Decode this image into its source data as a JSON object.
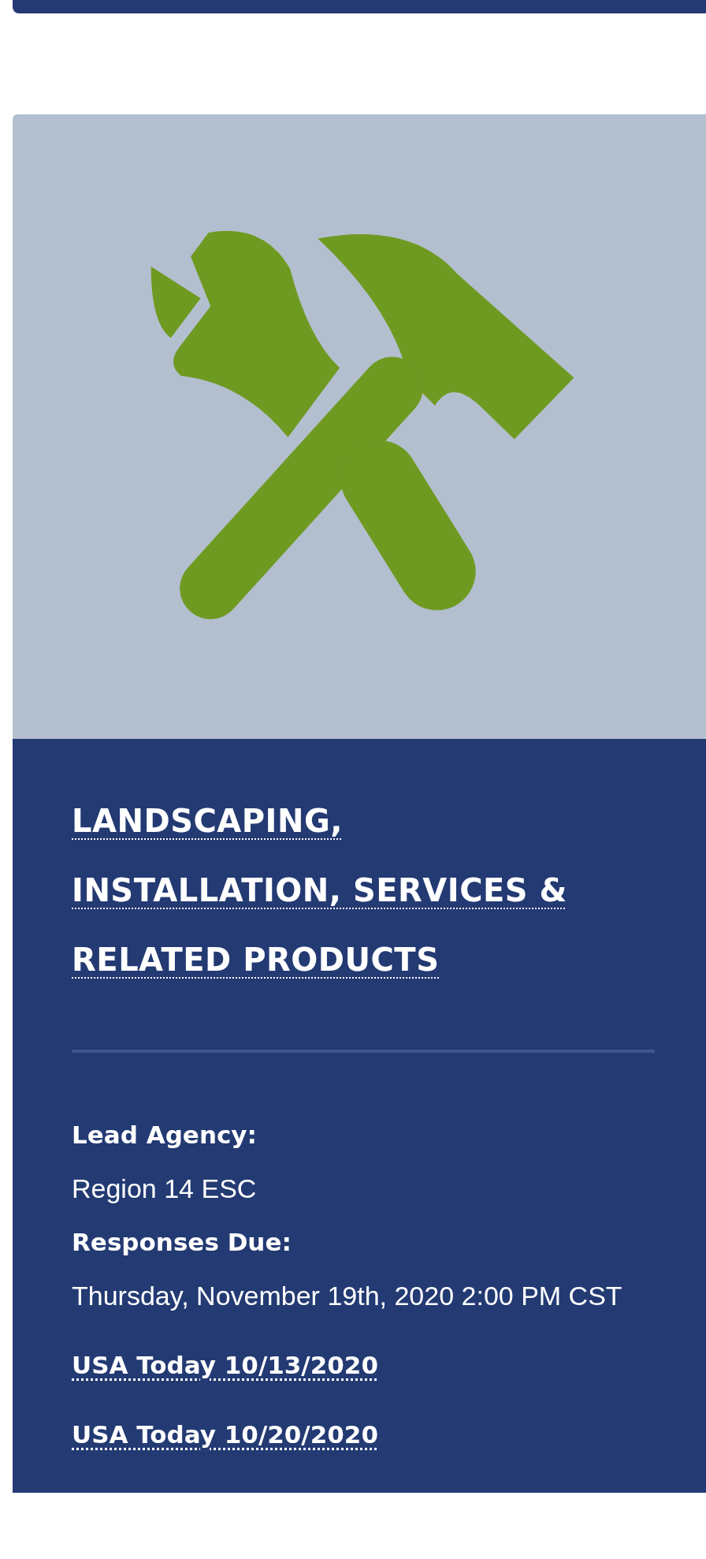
{
  "card": {
    "title": "LANDSCAPING, INSTALLATION, SERVICES & RELATED PRODUCTS",
    "details": [
      {
        "label": "Lead Agency:",
        "value": "Region 14 ESC"
      },
      {
        "label": "Responses Due:",
        "value": "Thursday, November 19th, 2020 2:00 PM CST"
      }
    ],
    "links": [
      "USA Today 10/13/2020",
      "USA Today 10/20/2020"
    ]
  }
}
